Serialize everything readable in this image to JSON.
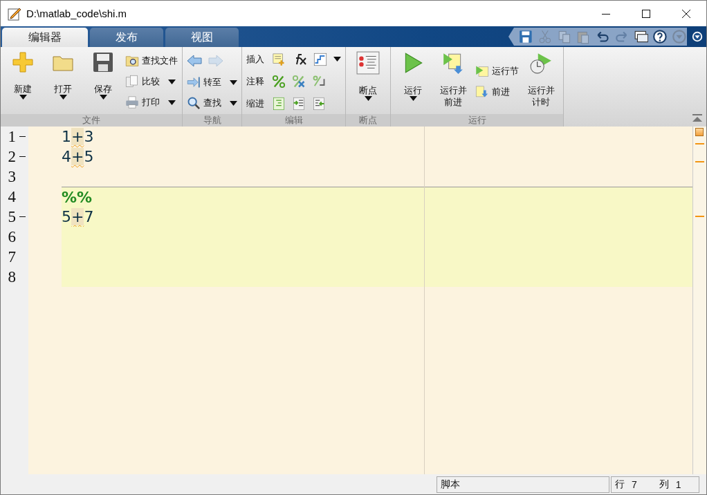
{
  "window": {
    "title": "D:\\matlab_code\\shi.m"
  },
  "tabs": [
    {
      "label": "编辑器",
      "selected": true
    },
    {
      "label": "发布",
      "selected": false
    },
    {
      "label": "视图",
      "selected": false
    }
  ],
  "quick_access": [
    {
      "disabled": false
    },
    {
      "disabled": true
    },
    {
      "disabled": true
    },
    {
      "disabled": true
    },
    {
      "disabled": false
    },
    {
      "disabled": true
    },
    {
      "disabled": false
    },
    {
      "disabled": false
    },
    {
      "disabled": true
    }
  ],
  "ribbon": [
    {
      "title": "文件",
      "columns": [
        {
          "kind": "large",
          "label": "新建",
          "dropdown": true
        },
        {
          "kind": "large",
          "label": "打开",
          "dropdown": true
        },
        {
          "kind": "large",
          "label": "保存",
          "dropdown": true
        },
        {
          "kind": "stack",
          "items": [
            {
              "label": "查找文件"
            },
            {
              "label": "比较",
              "dropdown": true
            },
            {
              "label": "打印",
              "dropdown": true
            }
          ]
        }
      ]
    },
    {
      "title": "导航",
      "columns": [
        {
          "kind": "nav",
          "back_disabled": false,
          "forward_disabled": true,
          "items": [
            {
              "label": "转至",
              "dropdown": true
            },
            {
              "label": "查找",
              "dropdown": true
            }
          ]
        }
      ]
    },
    {
      "title": "编辑",
      "columns": [
        {
          "kind": "iconrows",
          "rows": [
            {
              "label": "插入",
              "dropdown": true
            },
            {
              "label": "注释"
            },
            {
              "label": "缩进"
            }
          ]
        }
      ]
    },
    {
      "title": "断点",
      "columns": [
        {
          "kind": "large",
          "label": "断点",
          "dropdown": true
        }
      ]
    },
    {
      "title": "运行",
      "columns": [
        {
          "kind": "large",
          "label": "运行",
          "dropdown": true
        },
        {
          "kind": "large",
          "label": "运行并前进"
        },
        {
          "kind": "stack",
          "items": [
            {
              "label": "运行节"
            },
            {
              "label": "前进"
            }
          ]
        },
        {
          "kind": "large",
          "label": "运行并计时"
        }
      ]
    }
  ],
  "editor": {
    "lines": [
      {
        "number": "1",
        "executable": true,
        "current_cell": false,
        "tokens": [
          {
            "text": "1",
            "warning": false
          },
          {
            "text": "+",
            "warning": true
          },
          {
            "text": "3",
            "warning": false
          }
        ]
      },
      {
        "number": "2",
        "executable": true,
        "current_cell": false,
        "tokens": [
          {
            "text": "4",
            "warning": false
          },
          {
            "text": "+",
            "warning": true
          },
          {
            "text": "5",
            "warning": false
          }
        ]
      },
      {
        "number": "3",
        "executable": false,
        "current_cell": false
      },
      {
        "number": "4",
        "executable": false,
        "current_cell": true,
        "kind": "section",
        "tokens": [
          {
            "text": "%%",
            "warning": false
          }
        ]
      },
      {
        "number": "5",
        "executable": true,
        "current_cell": true,
        "tokens": [
          {
            "text": "5",
            "warning": false
          },
          {
            "text": "+",
            "warning": true
          },
          {
            "text": "7",
            "warning": false
          }
        ]
      },
      {
        "number": "6",
        "executable": false,
        "current_cell": true
      },
      {
        "number": "7",
        "executable": false,
        "current_cell": true
      },
      {
        "number": "8",
        "executable": false,
        "current_cell": true
      }
    ]
  },
  "status_bar": {
    "mode": "脚本",
    "line_label": "行",
    "line": "7",
    "col_label": "列",
    "col": "1"
  }
}
